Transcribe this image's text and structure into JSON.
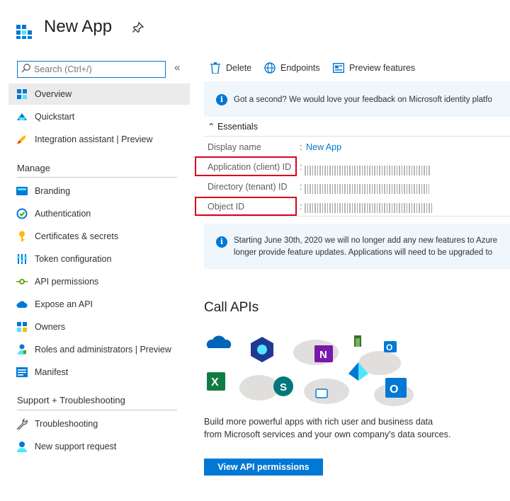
{
  "header": {
    "title": "New App"
  },
  "sidebar": {
    "search_placeholder": "Search (Ctrl+/)",
    "collapse": "«",
    "top_items": [
      {
        "label": "Overview",
        "icon": "overview-icon",
        "selected": true
      },
      {
        "label": "Quickstart",
        "icon": "quickstart-icon"
      },
      {
        "label": "Integration assistant | Preview",
        "icon": "rocket-icon"
      }
    ],
    "manage_header": "Manage",
    "manage_items": [
      {
        "label": "Branding",
        "icon": "branding-icon"
      },
      {
        "label": "Authentication",
        "icon": "authentication-icon"
      },
      {
        "label": "Certificates & secrets",
        "icon": "key-icon"
      },
      {
        "label": "Token configuration",
        "icon": "token-icon"
      },
      {
        "label": "API permissions",
        "icon": "api-permissions-icon"
      },
      {
        "label": "Expose an API",
        "icon": "cloud-icon"
      },
      {
        "label": "Owners",
        "icon": "owners-icon"
      },
      {
        "label": "Roles and administrators | Preview",
        "icon": "roles-icon"
      },
      {
        "label": "Manifest",
        "icon": "manifest-icon"
      }
    ],
    "support_header": "Support + Troubleshooting",
    "support_items": [
      {
        "label": "Troubleshooting",
        "icon": "wrench-icon"
      },
      {
        "label": "New support request",
        "icon": "support-icon"
      }
    ]
  },
  "commands": {
    "delete": "Delete",
    "endpoints": "Endpoints",
    "preview": "Preview features"
  },
  "feedback_banner": {
    "text": "Got a second? We would love your feedback on Microsoft identity platfo"
  },
  "essentials": {
    "header": "Essentials",
    "rows": [
      {
        "label": "Display name",
        "value": "New App"
      },
      {
        "label": "Application (client) ID"
      },
      {
        "label": "Directory (tenant) ID"
      },
      {
        "label": "Object ID"
      }
    ]
  },
  "notice_banner": {
    "line1": "Starting June 30th, 2020 we will no longer add any new features to Azure",
    "line2": "longer provide feature updates. Applications will need to be upgraded to"
  },
  "call_apis": {
    "title": "Call APIs",
    "description": "Build more powerful apps with rich user and business data from Microsoft services and your own company's data sources.",
    "button": "View API permissions"
  },
  "colors": {
    "accent": "#0078d4",
    "highlight": "#d9001b",
    "selected": "#edebe9",
    "banner": "#eff6fc"
  }
}
